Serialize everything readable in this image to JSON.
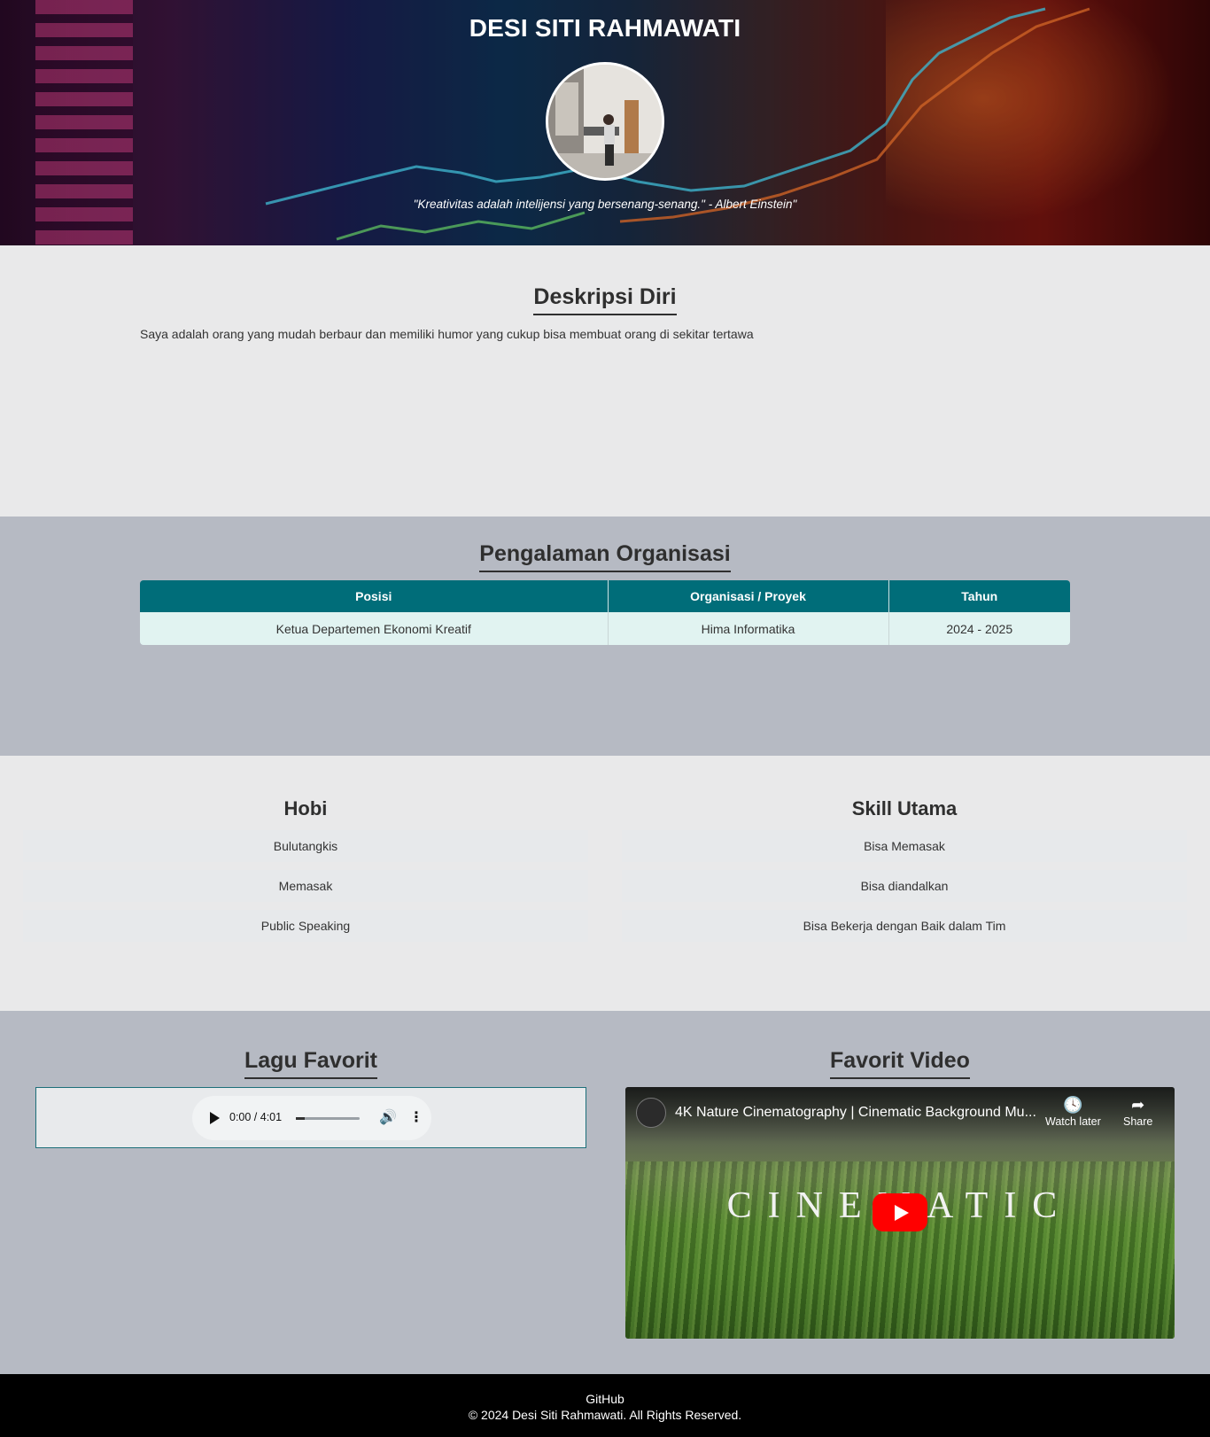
{
  "hero": {
    "name": "DESI SITI RAHMAWATI",
    "quote": "\"Kreativitas adalah intelijensi yang bersenang-senang.\" - Albert Einstein\""
  },
  "description": {
    "title": "Deskripsi Diri",
    "text": "Saya adalah orang yang mudah berbaur dan memiliki humor yang cukup bisa membuat orang di sekitar tertawa"
  },
  "organization": {
    "title": "Pengalaman Organisasi",
    "headers": [
      "Posisi",
      "Organisasi / Proyek",
      "Tahun"
    ],
    "rows": [
      [
        "Ketua Departemen Ekonomi Kreatif",
        "Hima Informatika",
        "2024 - 2025"
      ]
    ]
  },
  "hobbies": {
    "title": "Hobi",
    "items": [
      "Bulutangkis",
      "Memasak",
      "Public Speaking"
    ]
  },
  "skills": {
    "title": "Skill Utama",
    "items": [
      "Bisa Memasak",
      "Bisa diandalkan",
      "Bisa Bekerja dengan Baik dalam Tim"
    ]
  },
  "song": {
    "title": "Lagu Favorit",
    "time": "0:00 / 4:01"
  },
  "video": {
    "title": "Favorit Video",
    "video_title": "4K Nature Cinematography | Cinematic Background Mu...",
    "watch_later": "Watch later",
    "share": "Share",
    "overlay_text": "CINEMATIC"
  },
  "footer": {
    "link": "GitHub",
    "copyright": "© 2024 Desi Siti Rahmawati. All Rights Reserved."
  },
  "colors": {
    "table_header": "#006d79",
    "table_row": "#e1f3f1",
    "section_alt": "#b6bac3",
    "footer": "#000000"
  }
}
